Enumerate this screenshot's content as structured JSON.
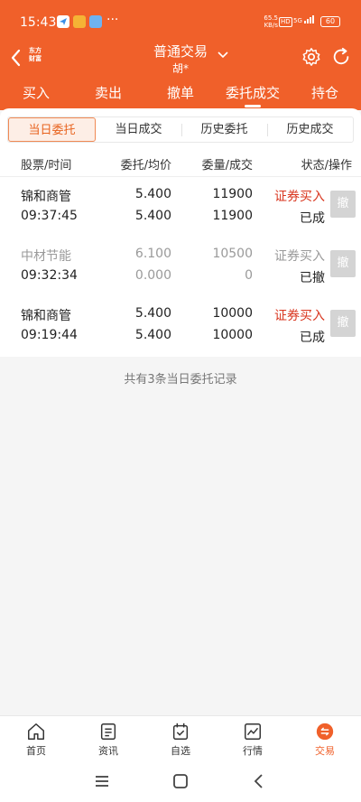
{
  "status_bar": {
    "time": "15:43",
    "speed_value": "65.5",
    "speed_unit": "KB/s",
    "hd": "HD",
    "network": "5G",
    "battery": "60"
  },
  "header": {
    "logo_line1": "东方",
    "logo_line2": "财富",
    "title": "普通交易",
    "subtitle": "胡*"
  },
  "main_tabs": [
    {
      "label": "买入"
    },
    {
      "label": "卖出"
    },
    {
      "label": "撤单"
    },
    {
      "label": "委托成交"
    },
    {
      "label": "持仓"
    }
  ],
  "sub_tabs": [
    {
      "label": "当日委托"
    },
    {
      "label": "当日成交"
    },
    {
      "label": "历史委托"
    },
    {
      "label": "历史成交"
    }
  ],
  "columns": {
    "name_time": "股票/时间",
    "price": "委托/均价",
    "qty": "委量/成交",
    "status": "状态/操作"
  },
  "orders": [
    {
      "name": "锦和商管",
      "time": "09:37:45",
      "order_price": "5.400",
      "avg_price": "5.400",
      "order_qty": "11900",
      "filled_qty": "11900",
      "type": "证券买入",
      "state": "已成",
      "cancel": "撤"
    },
    {
      "name": "中材节能",
      "time": "09:32:34",
      "order_price": "6.100",
      "avg_price": "0.000",
      "order_qty": "10500",
      "filled_qty": "0",
      "type": "证券买入",
      "state": "已撤",
      "cancel": "撤"
    },
    {
      "name": "锦和商管",
      "time": "09:19:44",
      "order_price": "5.400",
      "avg_price": "5.400",
      "order_qty": "10000",
      "filled_qty": "10000",
      "type": "证券买入",
      "state": "已成",
      "cancel": "撤"
    }
  ],
  "footer_text": "共有3条当日委托记录",
  "bottom_nav": [
    {
      "label": "首页",
      "icon": "home-icon"
    },
    {
      "label": "资讯",
      "icon": "news-icon"
    },
    {
      "label": "自选",
      "icon": "watchlist-icon"
    },
    {
      "label": "行情",
      "icon": "market-icon"
    },
    {
      "label": "交易",
      "icon": "trade-icon"
    }
  ],
  "colors": {
    "brand": "#f0602a",
    "sell_red": "#d9361f",
    "muted": "#9a9a9a"
  }
}
